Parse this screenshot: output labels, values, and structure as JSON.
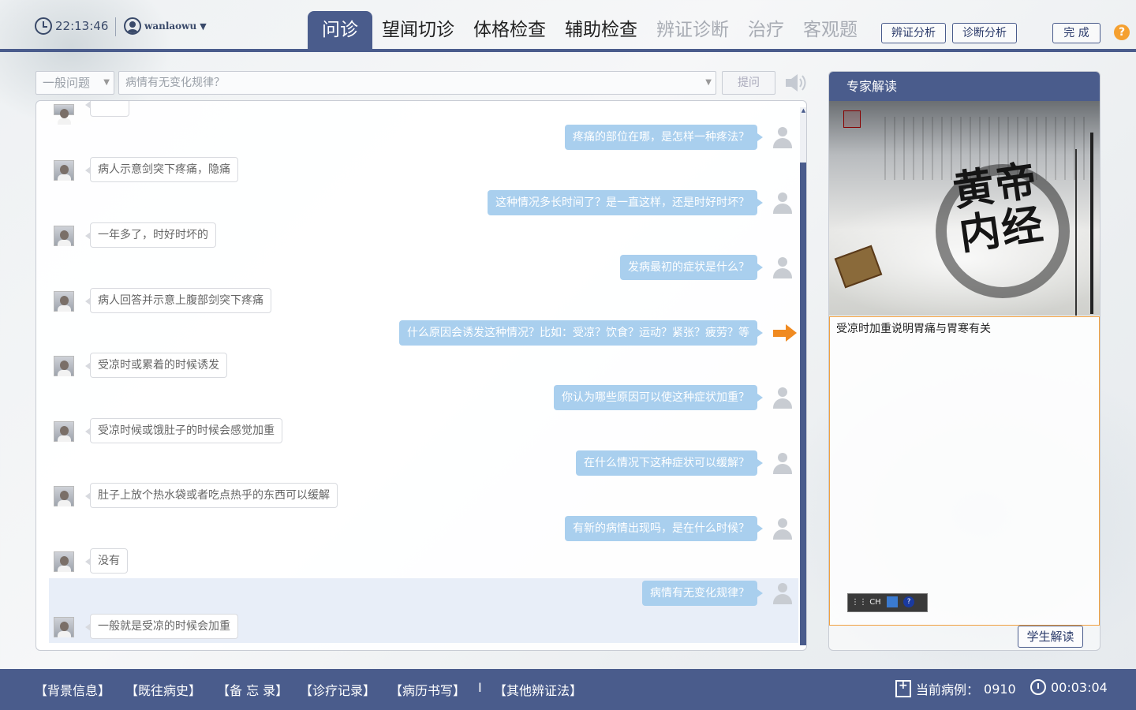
{
  "header": {
    "clock_time": "22:13:46",
    "username": "wanlaowu",
    "tabs": [
      {
        "label": "问诊",
        "state": "active"
      },
      {
        "label": "望闻切诊",
        "state": "normal"
      },
      {
        "label": "体格检查",
        "state": "normal"
      },
      {
        "label": "辅助检查",
        "state": "normal"
      },
      {
        "label": "辨证诊断",
        "state": "disabled"
      },
      {
        "label": "治疗",
        "state": "disabled"
      },
      {
        "label": "客观题",
        "state": "disabled"
      }
    ],
    "btn_syndrome": "辨证分析",
    "btn_diagnosis": "诊断分析",
    "btn_finish": "完 成",
    "help": "?"
  },
  "question_bar": {
    "category": "一般问题",
    "question": "病情有无变化规律？",
    "ask_label": "提问"
  },
  "chat": {
    "messages": [
      {
        "side": "right",
        "text": "疼痛的部位在哪，是怎样一种疼法？"
      },
      {
        "side": "left",
        "text": "病人示意剑突下疼痛，隐痛"
      },
      {
        "side": "right",
        "text": "这种情况多长时间了？是一直这样，还是时好时坏？"
      },
      {
        "side": "left",
        "text": "一年多了，时好时坏的"
      },
      {
        "side": "right",
        "text": "发病最初的症状是什么？"
      },
      {
        "side": "left",
        "text": "病人回答并示意上腹部剑突下疼痛"
      },
      {
        "side": "right",
        "text": "什么原因会诱发这种情况？比如：受凉？饮食？运动？紧张？疲劳？等",
        "marker": "arrow"
      },
      {
        "side": "left",
        "text": "受凉时或累着的时候诱发"
      },
      {
        "side": "right",
        "text": "你认为哪些原因可以使这种症状加重？"
      },
      {
        "side": "left",
        "text": "受凉时候或饿肚子的时候会感觉加重"
      },
      {
        "side": "right",
        "text": "在什么情况下这种症状可以缓解？"
      },
      {
        "side": "left",
        "text": "肚子上放个热水袋或者吃点热乎的东西可以缓解"
      },
      {
        "side": "right",
        "text": "有新的病情出现吗，是在什么时候？"
      },
      {
        "side": "left",
        "text": "没有"
      },
      {
        "side": "right",
        "text": "病情有无变化规律？"
      },
      {
        "side": "left",
        "text": "一般就是受凉的时候会加重"
      }
    ]
  },
  "expert": {
    "title": "专家解读",
    "book_title": "黄帝内经",
    "note": "受凉时加重说明胃痛与胃寒有关",
    "ime_label": "CH",
    "student_btn": "学生解读"
  },
  "footer": {
    "links": [
      "【背景信息】",
      "【既往病史】",
      "【备 忘 录】",
      "【诊疗记录】",
      "【病历书写】",
      "【其他辨证法】"
    ],
    "separator": "I",
    "case_label": "当前病例：",
    "case_number": "0910",
    "elapsed": "00:03:04"
  },
  "colors": {
    "primary": "#4a5c8c",
    "user_bubble": "#a9cfee",
    "accent": "#f5a030"
  }
}
